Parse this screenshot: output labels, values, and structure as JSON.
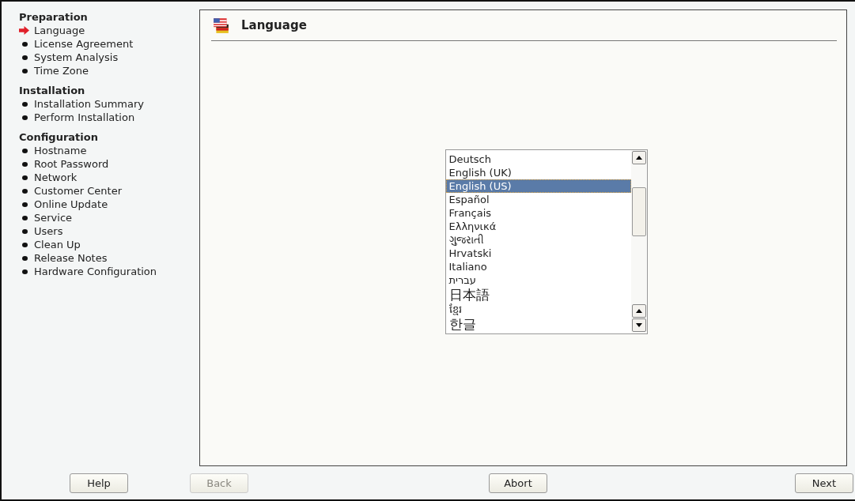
{
  "sidebar": {
    "sections": [
      {
        "title": "Preparation",
        "items": [
          {
            "label": "Language",
            "selected": true
          },
          {
            "label": "License Agreement",
            "selected": false
          },
          {
            "label": "System Analysis",
            "selected": false
          },
          {
            "label": "Time Zone",
            "selected": false
          }
        ]
      },
      {
        "title": "Installation",
        "items": [
          {
            "label": "Installation Summary",
            "selected": false
          },
          {
            "label": "Perform Installation",
            "selected": false
          }
        ]
      },
      {
        "title": "Configuration",
        "items": [
          {
            "label": "Hostname",
            "selected": false
          },
          {
            "label": "Root Password",
            "selected": false
          },
          {
            "label": "Network",
            "selected": false
          },
          {
            "label": "Customer Center",
            "selected": false
          },
          {
            "label": "Online Update",
            "selected": false
          },
          {
            "label": "Service",
            "selected": false
          },
          {
            "label": "Users",
            "selected": false
          },
          {
            "label": "Clean Up",
            "selected": false
          },
          {
            "label": "Release Notes",
            "selected": false
          },
          {
            "label": "Hardware Configuration",
            "selected": false
          }
        ]
      }
    ]
  },
  "page": {
    "title": "Language"
  },
  "language_list": {
    "items": [
      {
        "label": "Deutsch",
        "selected": false,
        "large": false
      },
      {
        "label": "English (UK)",
        "selected": false,
        "large": false
      },
      {
        "label": "English (US)",
        "selected": true,
        "large": false
      },
      {
        "label": "Español",
        "selected": false,
        "large": false
      },
      {
        "label": "Français",
        "selected": false,
        "large": false
      },
      {
        "label": "Ελληνικά",
        "selected": false,
        "large": false
      },
      {
        "label": "ગુજરાતી",
        "selected": false,
        "large": false
      },
      {
        "label": "Hrvatski",
        "selected": false,
        "large": false
      },
      {
        "label": "Italiano",
        "selected": false,
        "large": false
      },
      {
        "label": "עברית",
        "selected": false,
        "large": false
      },
      {
        "label": "日本語",
        "selected": false,
        "large": true
      },
      {
        "label": "ខ្មែរ",
        "selected": false,
        "large": false
      },
      {
        "label": "한글",
        "selected": false,
        "large": true
      }
    ]
  },
  "buttons": [
    {
      "label": "Help",
      "disabled": false
    },
    {
      "label": "Back",
      "disabled": true
    },
    {
      "label": "Abort",
      "disabled": false
    },
    {
      "label": "Next",
      "disabled": false
    }
  ]
}
